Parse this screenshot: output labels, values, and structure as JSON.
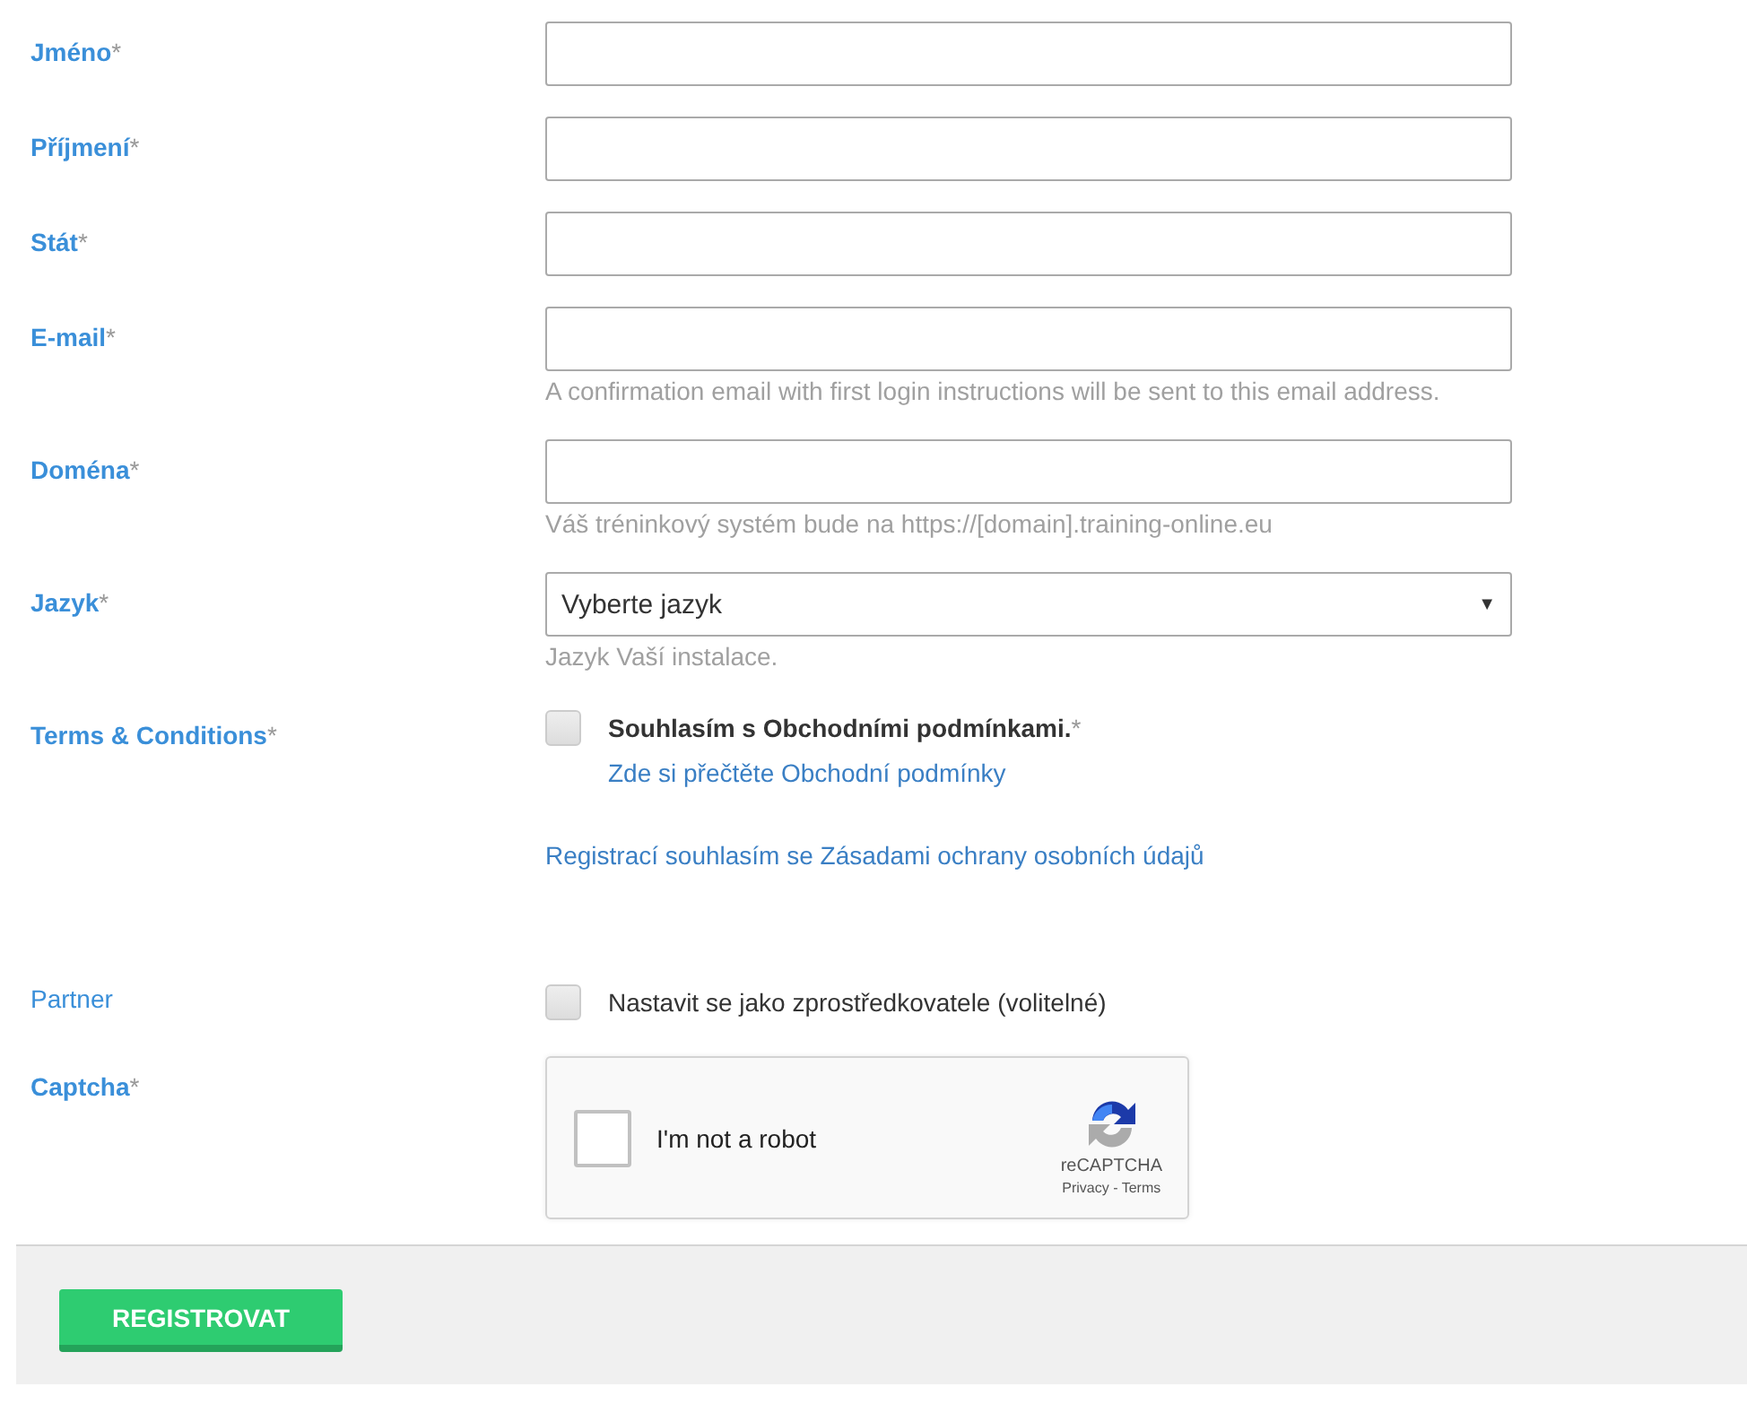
{
  "fields": [
    {
      "kind": "text",
      "label": "Jméno",
      "required": true,
      "mark": "*"
    },
    {
      "kind": "text",
      "label": "Příjmení",
      "required": true,
      "mark": "*"
    },
    {
      "kind": "text",
      "label": "Stát",
      "required": true,
      "mark": "*"
    },
    {
      "kind": "text",
      "label": "E-mail",
      "required": true,
      "mark": "*",
      "help": "A confirmation email with first login instructions will be sent to this email address."
    },
    {
      "kind": "text",
      "label": "Doména",
      "required": true,
      "mark": "*",
      "help": "Váš tréninkový systém bude na https://[domain].training-online.eu"
    },
    {
      "kind": "select",
      "label": "Jazyk",
      "required": true,
      "mark": "*",
      "value": "Vyberte jazyk",
      "arrow": "▼",
      "help": "Jazyk Vaší instalace."
    },
    {
      "kind": "terms",
      "label": "Terms & Conditions",
      "required": true,
      "mark": "*",
      "checked": false,
      "text": "Souhlasím s Obchodními podmínkami.",
      "text_mark": "*",
      "link": "Zde si přečtěte Obchodní podmínky",
      "privacy_link": "Registrací souhlasím se Zásadami ochrany osobních údajů"
    },
    {
      "kind": "checkbox",
      "label": "Partner",
      "required": false,
      "checked": false,
      "text": "Nastavit se jako zprostředkovatele (volitelné)"
    },
    {
      "kind": "captcha",
      "label": "Captcha",
      "required": true,
      "mark": "*",
      "checked": false,
      "text": "I'm not a robot",
      "brand": "reCAPTCHA",
      "links": [
        "Privacy",
        "Terms"
      ],
      "separator": "-"
    }
  ],
  "submit": {
    "label": "REGISTROVAT"
  }
}
